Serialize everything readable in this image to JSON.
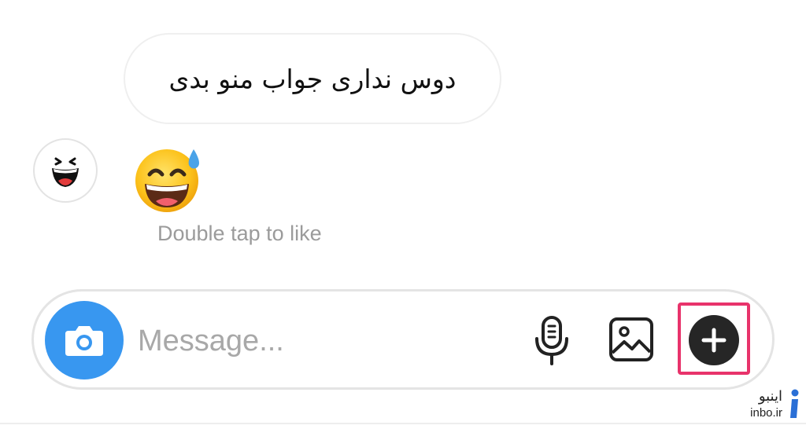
{
  "conversation": {
    "received_message": "دوس نداری جواب منو بدی",
    "emoji_message_icon": "grinning-face-with-sweat-emoji",
    "like_hint": "Double tap to like",
    "sender_avatar_icon": "laughing-face-avatar"
  },
  "composer": {
    "camera_icon": "camera-icon",
    "message_placeholder": "Message...",
    "mic_icon": "microphone-icon",
    "gallery_icon": "image-icon",
    "plus_icon": "plus-icon",
    "highlight_color": "#e8336b",
    "camera_color": "#3897f0"
  },
  "watermark": {
    "fa": "اینبو",
    "en": "inbo.ir",
    "logo_icon": "inbo-logo-icon"
  }
}
